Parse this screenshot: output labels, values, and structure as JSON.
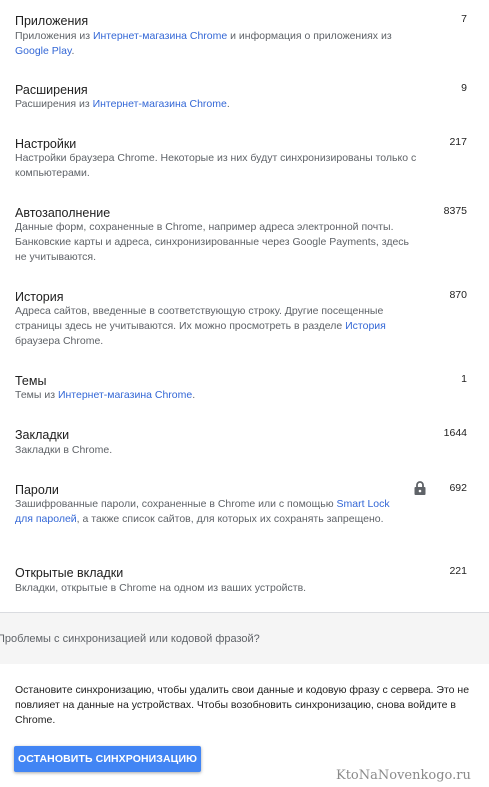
{
  "items": [
    {
      "title": "Приложения",
      "count": "7",
      "desc": [
        {
          "t": "Приложения из "
        },
        {
          "t": "Интернет-магазина Chrome",
          "link": true
        },
        {
          "t": " и информация о приложениях из "
        },
        {
          "t": "Google Play",
          "link": true
        },
        {
          "t": "."
        }
      ]
    },
    {
      "title": "Расширения",
      "count": "9",
      "desc": [
        {
          "t": "Расширения из "
        },
        {
          "t": "Интернет-магазина Chrome",
          "link": true
        },
        {
          "t": "."
        }
      ]
    },
    {
      "title": "Настройки",
      "count": "217",
      "desc": [
        {
          "t": "Настройки браузера Chrome. Некоторые из них будут синхронизированы только с компьютерами."
        }
      ]
    },
    {
      "title": "Автозаполнение",
      "count": "8375",
      "desc": [
        {
          "t": "Данные форм, сохраненные в Chrome, например адреса электронной почты. Банковские карты и адреса, синхронизированные через Google Payments, здесь не учитываются."
        }
      ]
    },
    {
      "title": "История",
      "count": "870",
      "desc": [
        {
          "t": "Адреса сайтов, введенные в соответствующую строку. Другие посещенные страницы здесь не учитываются. Их можно просмотреть в разделе "
        },
        {
          "t": "История",
          "link": true
        },
        {
          "t": " браузера Chrome."
        }
      ]
    },
    {
      "title": "Темы",
      "count": "1",
      "desc": [
        {
          "t": "Темы из "
        },
        {
          "t": "Интернет-магазина Chrome",
          "link": true
        },
        {
          "t": "."
        }
      ]
    },
    {
      "title": "Закладки",
      "count": "1644",
      "desc": [
        {
          "t": "Закладки в Chrome."
        }
      ]
    },
    {
      "title": "Пароли",
      "count": "692",
      "icon": "lock-icon",
      "desc": [
        {
          "t": "Зашифрованные пароли, сохраненные в Chrome или с помощью "
        },
        {
          "t": "Smart Lock для паролей",
          "link": true
        },
        {
          "t": ", а также список сайтов, для которых их сохранять запрещено."
        }
      ]
    },
    {
      "title": "Открытые вкладки",
      "count": "221",
      "desc": [
        {
          "t": "Вкладки, открытые в Chrome на одном из ваших устройств."
        }
      ]
    }
  ],
  "problem_text": "Проблемы с синхронизацией или кодовой фразой?",
  "stop_desc": "Остановите синхронизацию, чтобы удалить свои данные и кодовую фразу с сервера. Это не повлияет на данные на устройствах. Чтобы возобновить синхронизацию, снова войдите в Chrome.",
  "stop_button_label": "ОСТАНОВИТЬ СИНХРОНИЗАЦИЮ",
  "watermark": "KtoNaNovenkogo.ru",
  "colors": {
    "link": "#3367d6",
    "button": "#4285f4",
    "description": "#5f6368"
  }
}
